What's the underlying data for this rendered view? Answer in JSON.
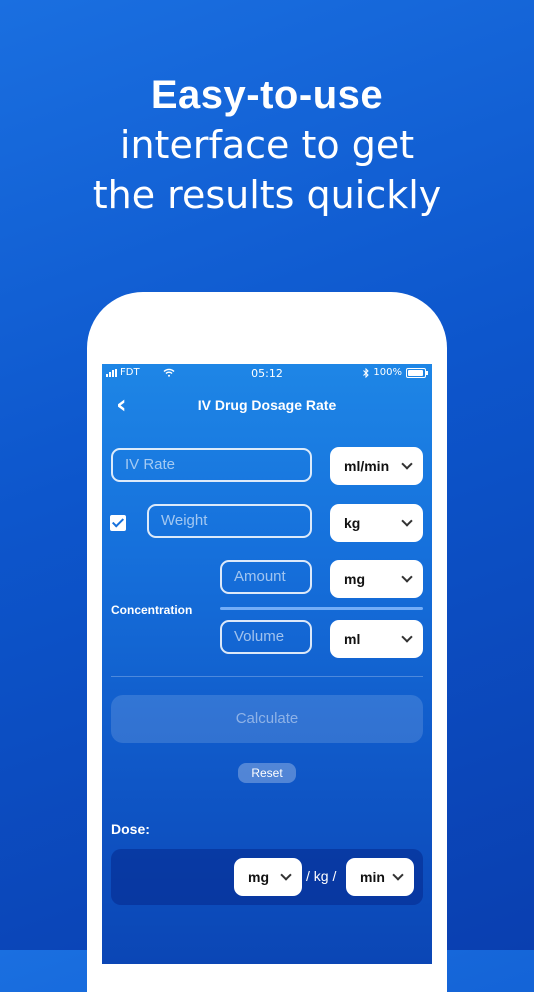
{
  "headline": {
    "bold": "Easy-to-use",
    "line1": "interface to get",
    "line2": "the results quickly"
  },
  "status_bar": {
    "carrier": "FDT",
    "time": "05:12",
    "battery": "100%",
    "icons": [
      "signal-bars-icon",
      "wifi-icon",
      "bluetooth-icon",
      "battery-icon"
    ]
  },
  "nav": {
    "title": "IV Drug Dosage Rate",
    "back_icon": "chevron-left-icon"
  },
  "form": {
    "iv_rate_placeholder": "IV Rate",
    "iv_rate_unit": "ml/min",
    "weight_placeholder": "Weight",
    "weight_unit": "kg",
    "weight_checked": true,
    "concentration_label": "Concentration",
    "amount_placeholder": "Amount",
    "amount_unit": "mg",
    "volume_placeholder": "Volume",
    "volume_unit": "ml"
  },
  "actions": {
    "calculate_label": "Calculate",
    "reset_label": "Reset"
  },
  "dose": {
    "label": "Dose:",
    "unit1": "mg",
    "separator": "/ kg /",
    "unit2": "min"
  },
  "colors": {
    "background_top": "#1a6fe0",
    "background_bottom": "#0a3fb0",
    "screen_top": "#1e86e6",
    "accent": "#1671dc"
  }
}
